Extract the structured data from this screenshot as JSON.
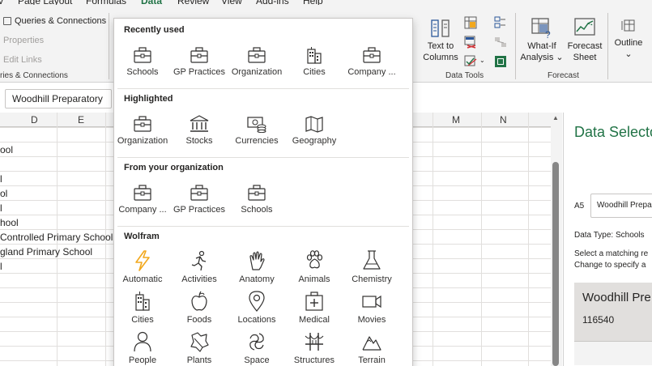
{
  "ribbon": {
    "tabs": [
      {
        "label": "v",
        "name": "tab-view-partial"
      },
      {
        "label": "Page Layout",
        "name": "tab-page-layout"
      },
      {
        "label": "Formulas",
        "name": "tab-formulas"
      },
      {
        "label": "Data",
        "name": "tab-data",
        "active": true
      },
      {
        "label": "Review",
        "name": "tab-review"
      },
      {
        "label": "View",
        "name": "tab-view"
      },
      {
        "label": "Add-ins",
        "name": "tab-add-ins"
      },
      {
        "label": "Help",
        "name": "tab-help"
      }
    ],
    "queries": {
      "queries_connections": "Queries & Connections",
      "properties": "Properties",
      "edit_links": "Edit Links",
      "group_label": "ries & Connections"
    },
    "data_tools": {
      "text_to_columns": "Text to",
      "text_to_columns_2": "Columns",
      "group_label": "Data Tools"
    },
    "forecast": {
      "what_if": "What-If",
      "what_if_2": "Analysis",
      "forecast_sheet": "Forecast",
      "forecast_sheet_2": "Sheet",
      "group_label": "Forecast"
    },
    "outline": {
      "label": "Outline"
    }
  },
  "formula_bar": {
    "value": "Woodhill Preparatory"
  },
  "grid": {
    "col_headers": [
      "D",
      "E",
      "M",
      "N"
    ],
    "cells": [
      {
        "row": 1,
        "text": "ool"
      },
      {
        "row": 3,
        "text": "l"
      },
      {
        "row": 4,
        "text": "ol"
      },
      {
        "row": 5,
        "text": "l"
      },
      {
        "row": 6,
        "text": "hool"
      },
      {
        "row": 7,
        "text": " Controlled Primary School"
      },
      {
        "row": 8,
        "text": "gland Primary School"
      },
      {
        "row": 9,
        "text": "l"
      }
    ]
  },
  "gallery": {
    "sections": [
      {
        "title": "Recently used",
        "items": [
          {
            "label": "Schools",
            "icon": "briefcase-icon"
          },
          {
            "label": "GP Practices",
            "icon": "briefcase-icon"
          },
          {
            "label": "Organization",
            "icon": "briefcase-icon"
          },
          {
            "label": "Cities",
            "icon": "city-icon"
          },
          {
            "label": "Company ...",
            "icon": "briefcase-icon"
          }
        ]
      },
      {
        "title": "Highlighted",
        "items": [
          {
            "label": "Organization",
            "icon": "briefcase-icon"
          },
          {
            "label": "Stocks",
            "icon": "bank-icon"
          },
          {
            "label": "Currencies",
            "icon": "currency-icon"
          },
          {
            "label": "Geography",
            "icon": "map-icon"
          }
        ]
      },
      {
        "title": "From your organization",
        "items": [
          {
            "label": "Company ...",
            "icon": "briefcase-icon"
          },
          {
            "label": "GP Practices",
            "icon": "briefcase-icon"
          },
          {
            "label": "Schools",
            "icon": "briefcase-icon"
          }
        ]
      },
      {
        "title": "Wolfram",
        "items": [
          {
            "label": "Automatic",
            "icon": "lightning-icon"
          },
          {
            "label": "Activities",
            "icon": "running-person-icon"
          },
          {
            "label": "Anatomy",
            "icon": "hand-icon"
          },
          {
            "label": "Animals",
            "icon": "paw-icon"
          },
          {
            "label": "Chemistry",
            "icon": "flask-icon"
          },
          {
            "label": "Cities",
            "icon": "city-icon"
          },
          {
            "label": "Foods",
            "icon": "apple-icon"
          },
          {
            "label": "Locations",
            "icon": "location-pin-icon"
          },
          {
            "label": "Medical",
            "icon": "medical-kit-icon"
          },
          {
            "label": "Movies",
            "icon": "video-camera-icon"
          },
          {
            "label": "People",
            "icon": "person-icon"
          },
          {
            "label": "Plants",
            "icon": "leaf-icon"
          },
          {
            "label": "Space",
            "icon": "galaxy-icon"
          },
          {
            "label": "Structures",
            "icon": "bridge-icon"
          },
          {
            "label": "Terrain",
            "icon": "mountain-icon"
          }
        ]
      }
    ]
  },
  "task_pane": {
    "title": "Data Selecto",
    "cell_ref": "A5",
    "input_value": "Woodhill Prepa",
    "data_type_line": "Data Type: Schools",
    "help_line_1": "Select a matching re",
    "help_line_2": "Change to specify a",
    "result_title": "Woodhill Pre",
    "result_id": "116540"
  },
  "colors": {
    "accent": "#217346",
    "automatic_icon": "#f2a81d"
  }
}
